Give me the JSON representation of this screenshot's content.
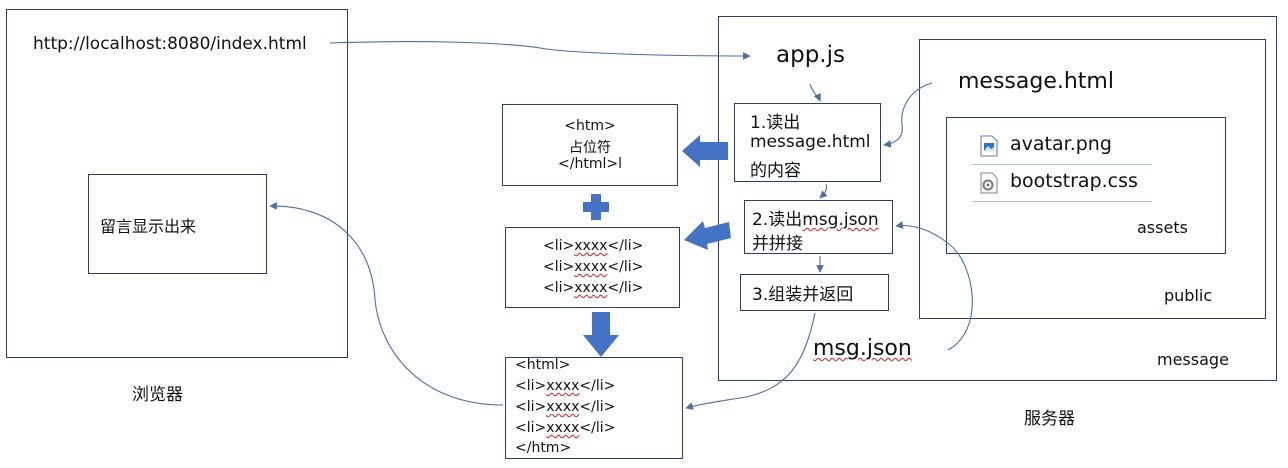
{
  "browser": {
    "url": "http://localhost:8080/index.html",
    "message_display": "留言显示出来",
    "caption": "浏览器"
  },
  "server": {
    "caption": "服务器",
    "folder_message": "message",
    "folder_public": "public",
    "folder_assets": "assets",
    "app_js": "app.js",
    "message_html": "message.html",
    "msg_json": "msg.json",
    "files": [
      {
        "name": "avatar.png",
        "icon": "image-file-icon"
      },
      {
        "name": "bootstrap.css",
        "icon": "css-file-icon"
      }
    ],
    "steps": {
      "step1": [
        "1.读出",
        "message.html",
        "的内容"
      ],
      "step2_prefix": "2.读出",
      "step2_json": "msg.json",
      "step2_suffix": "并拼接",
      "step3": "3.组装并返回"
    }
  },
  "template": {
    "lines": [
      "<htm>",
      "占位符",
      "</html>l"
    ]
  },
  "list_items": {
    "open": "<li>",
    "word": "xxxx",
    "close": "</li>",
    "count": 3
  },
  "output": {
    "open_html": "<html>",
    "close_htm": "</htm>"
  },
  "colors": {
    "box_border": "#2a3f66",
    "arrow_fill": "#4472c4",
    "line": "#4a6fa5",
    "wavy": "#d21f1f"
  }
}
